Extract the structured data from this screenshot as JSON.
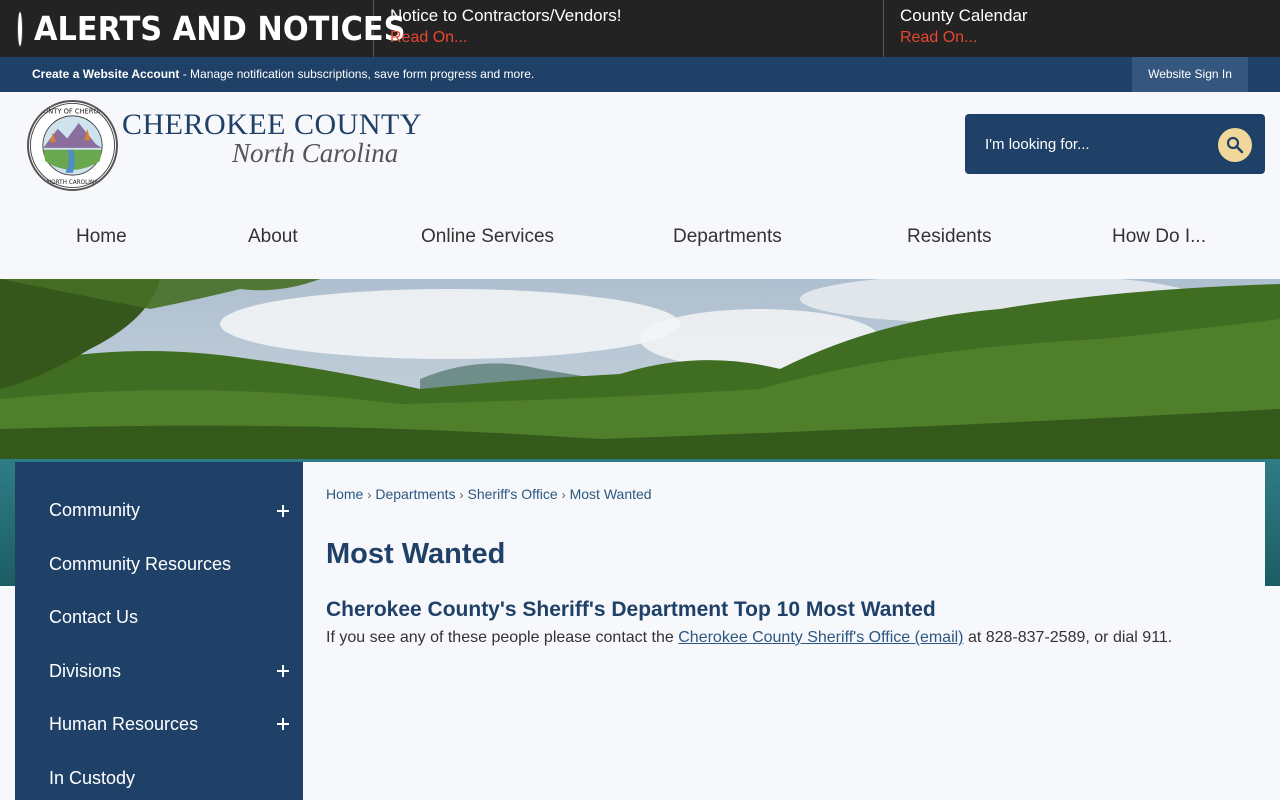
{
  "alerts": {
    "title": "ALERTS AND NOTICES",
    "items": [
      {
        "title": "Notice to Contractors/Vendors!",
        "link": "Read On..."
      },
      {
        "title": "County Calendar",
        "link": "Read On..."
      }
    ]
  },
  "account_bar": {
    "create_label": "Create a Website Account",
    "description": " - Manage notification subscriptions, save form progress and more.",
    "sign_in": "Website Sign In"
  },
  "logo": {
    "name": "CHEROKEE COUNTY",
    "subtitle": "North Carolina",
    "seal_top": "COUNTY OF CHEROKEE",
    "seal_bottom": "NORTH CAROLINA"
  },
  "search": {
    "placeholder": "I'm looking for...",
    "icon": "search-icon"
  },
  "nav": {
    "items": [
      "Home",
      "About",
      "Online Services",
      "Departments",
      "Residents",
      "How Do I..."
    ]
  },
  "sidebar": {
    "items": [
      {
        "label": "Community",
        "expandable": true
      },
      {
        "label": "Community Resources",
        "expandable": false
      },
      {
        "label": "Contact Us",
        "expandable": false
      },
      {
        "label": "Divisions",
        "expandable": true
      },
      {
        "label": "Human Resources",
        "expandable": true
      },
      {
        "label": "In Custody",
        "expandable": false
      }
    ]
  },
  "breadcrumb": [
    "Home",
    "Departments",
    "Sheriff's Office",
    "Most Wanted"
  ],
  "main": {
    "title": "Most Wanted",
    "subtitle": "Cherokee County's Sheriff's Department Top 10 Most Wanted",
    "text_before": "If you see any of these people please contact the ",
    "link_text": "Cherokee County Sheriff's Office (email)",
    "text_after": " at 828-837-2589, or dial 911."
  },
  "colors": {
    "brand_navy": "#1f4168",
    "alert_red": "#e8462e",
    "search_button": "#f1d89a"
  }
}
